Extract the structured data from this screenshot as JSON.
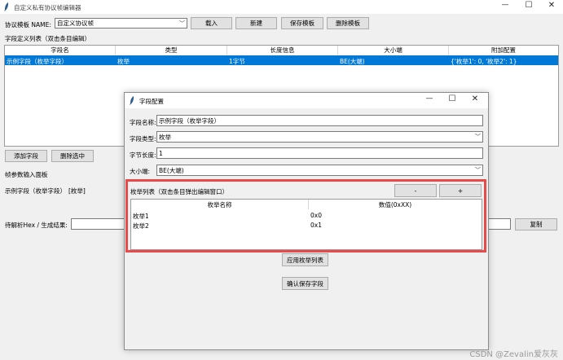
{
  "main_window": {
    "title": "自定义私有协议帧编辑器",
    "controls": {
      "minimize": "—",
      "maximize": "☐",
      "close": "✕"
    }
  },
  "toolbar": {
    "template_label": "协议模板 NAME:",
    "template_value": "自定义协议帧",
    "load_button": "载入",
    "new_button": "新建",
    "save_template_button": "保存模板",
    "delete_template_button": "删除模板"
  },
  "field_list": {
    "label": "字段定义列表（双击条目编辑）",
    "columns": [
      "字段名",
      "类型",
      "长度信息",
      "大小端",
      "附加配置"
    ],
    "rows": [
      {
        "name": "示例字段（枚举字段）",
        "type": "枚举",
        "length": "1字节",
        "endian": "BE(大端)",
        "extra": "{'枚举1': 0, '枚举2': 1}"
      }
    ]
  },
  "field_buttons": {
    "add": "添加字段",
    "delete_selected": "删除选中"
  },
  "param_panel": {
    "label": "帧参数输入面板",
    "field_label": "示例字段（枚举字段）",
    "field_type": "[枚举]"
  },
  "hex_area": {
    "label": "待解析Hex / 生成结果:",
    "value": "",
    "copy_button": "复制"
  },
  "dialog": {
    "title": "字段配置",
    "controls": {
      "minimize": "—",
      "maximize": "☐",
      "close": "✕"
    },
    "name_label": "字段名称:",
    "name_value": "示例字段（枚举字段）",
    "type_label": "字段类型:",
    "type_value": "枚举",
    "length_label": "字节长度:",
    "length_value": "1",
    "endian_label": "大小端:",
    "endian_value": "BE(大端)",
    "enum_list_label": "枚举列表（双击条目弹出编辑窗口）",
    "minus_button": "-",
    "plus_button": "+",
    "enum_columns": [
      "枚举名称",
      "数值(0xXX)"
    ],
    "enum_rows": [
      {
        "name": "枚举1",
        "value": "0x0"
      },
      {
        "name": "枚举2",
        "value": "0x1"
      }
    ],
    "apply_enum_button": "应用枚举列表",
    "confirm_save_button": "确认保存字段"
  },
  "watermark": "CSDN @Zevalin爱灰灰",
  "colors": {
    "selection": "#0078d7",
    "highlight_border": "#e84a4a",
    "window_bg": "#f0f0f0"
  }
}
